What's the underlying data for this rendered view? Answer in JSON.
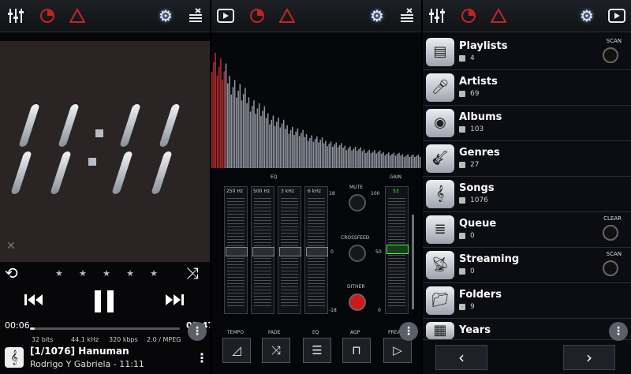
{
  "player": {
    "clock": "11:11",
    "rating_stars": [
      "★",
      "★",
      "★",
      "★",
      "★"
    ],
    "elapsed": "00:06",
    "duration": "03:47",
    "progress": 0.03,
    "bits": "32 bits",
    "rate": "44.1 kHz",
    "bitrate": "320 kbps",
    "format": "2.0 / MPEG",
    "track_title": "[1/1076] Hanuman",
    "track_artist": "Rodrigo Y Gabriela - 11:11",
    "more": "⋮"
  },
  "dsp": {
    "eq_title": "EQ",
    "gain_title": "GAIN",
    "bands": [
      "250 Hz",
      "500 Hz",
      "3 kHz",
      "6 kHz"
    ],
    "scale_top": "18",
    "scale_mid": "0",
    "scale_bottom": "-18",
    "gain_top": "100",
    "gain_mid": "50",
    "gain_bottom": "0",
    "gain_value": "53",
    "mute_label": "MUTE",
    "crossfeed_label": "CROSSFEED",
    "dither_label": "DITHER",
    "bottom_labels": [
      "TEMPO",
      "FADE",
      "EQ",
      "AGP",
      "PREAMP"
    ]
  },
  "library": {
    "items": [
      {
        "title": "Playlists",
        "count": "4",
        "action": "SCAN"
      },
      {
        "title": "Artists",
        "count": "69",
        "action": ""
      },
      {
        "title": "Albums",
        "count": "103",
        "action": ""
      },
      {
        "title": "Genres",
        "count": "27",
        "action": ""
      },
      {
        "title": "Songs",
        "count": "1076",
        "action": ""
      },
      {
        "title": "Queue",
        "count": "0",
        "action": "CLEAR"
      },
      {
        "title": "Streaming",
        "count": "0",
        "action": "SCAN"
      },
      {
        "title": "Folders",
        "count": "9",
        "action": ""
      },
      {
        "title": "Years",
        "count": "",
        "action": ""
      }
    ],
    "prev": "‹",
    "next": "›"
  },
  "colors": {
    "accent_red": "#c32424",
    "green_value": "#3aff3a",
    "bg": "#000000"
  },
  "icons": [
    "equalizer-icon",
    "sleep-timer-icon",
    "warning-triangle-icon",
    "gear-icon",
    "queue-list-icon",
    "play-icon"
  ]
}
